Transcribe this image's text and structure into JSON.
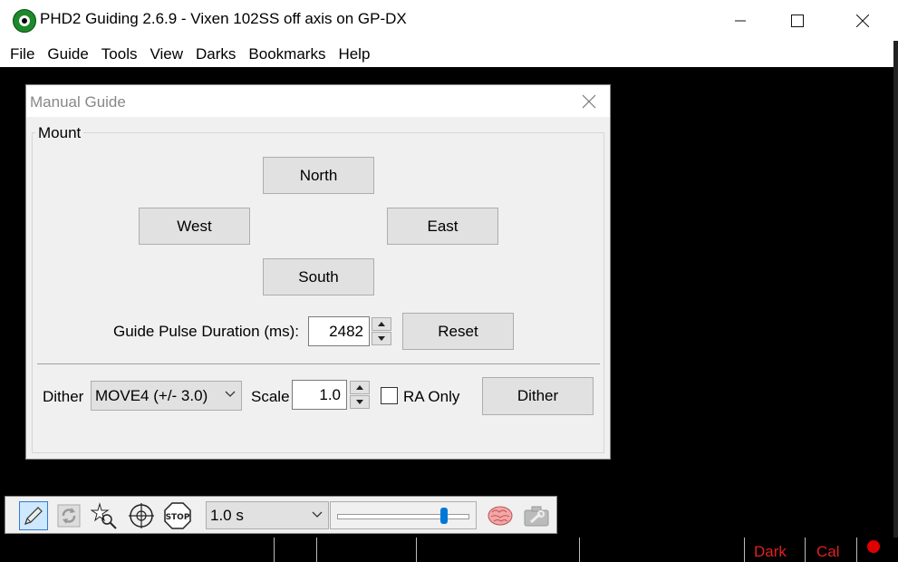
{
  "window": {
    "title": "PHD2 Guiding 2.6.9 - Vixen 102SS off axis on GP-DX"
  },
  "menu": [
    "File",
    "Guide",
    "Tools",
    "View",
    "Darks",
    "Bookmarks",
    "Help"
  ],
  "dialog": {
    "title": "Manual Guide",
    "group_label": "Mount",
    "buttons": {
      "north": "North",
      "west": "West",
      "east": "East",
      "south": "South",
      "reset": "Reset",
      "dither": "Dither"
    },
    "pulse": {
      "label": "Guide Pulse Duration (ms):",
      "value": "2482"
    },
    "dither": {
      "label": "Dither",
      "mode": "MOVE4 (+/- 3.0)",
      "scale_label": "Scale",
      "scale_value": "1.0",
      "ra_only_label": "RA Only",
      "ra_only_checked": false
    }
  },
  "toolbar": {
    "exposure": "1.0 s",
    "gamma_fraction": 0.82,
    "icons": [
      "pencil-icon",
      "loop-icon",
      "star-search-icon",
      "crosshair-icon",
      "stop-icon",
      "brain-icon",
      "camera-settings-icon"
    ]
  },
  "status": {
    "dark": "Dark",
    "cal": "Cal",
    "accent": "#e02020"
  }
}
